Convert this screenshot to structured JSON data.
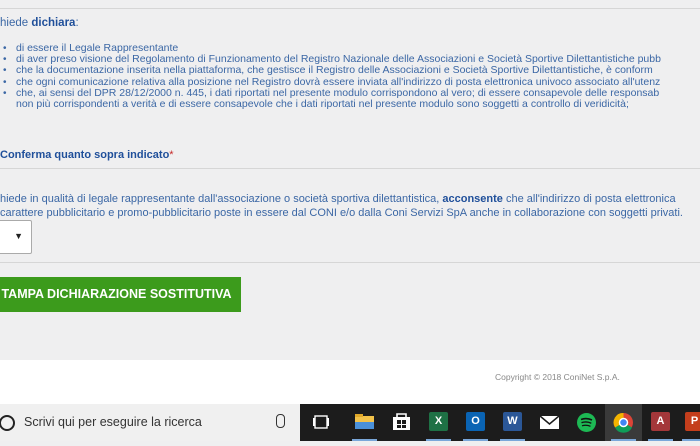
{
  "form": {
    "intro_prefix": "hiede ",
    "intro_bold": "dichiara",
    "intro_suffix": ":",
    "declarations": [
      "di essere il Legale Rappresentante",
      "di aver preso visione del Regolamento di Funzionamento del Registro Nazionale delle Associazioni e Società Sportive Dilettantistiche pubb",
      "che la documentazione inserita nella piattaforma, che gestisce il Registro delle Associazioni e Società Sportive Dilettantistiche, è conform",
      "che ogni comunicazione relativa alla posizione nel Registro dovrà essere inviata all'indirizzo di posta elettronica univoco associato all'utenz",
      "che, ai sensi del DPR 28/12/2000 n. 445, i dati riportati nel presente modulo corrispondono al vero; di essere consapevole delle responsab"
    ],
    "declaration_continuation": "non più corrispondenti a verità e di essere consapevole che i dati riportati nel presente modulo sono soggetti a controllo di veridicità;",
    "conferma_label": "Conferma quanto sopra indicato",
    "required_mark": "*",
    "consenso_line1_prefix": "hiede in qualità di legale rappresentante dall'associazione o società sportiva dilettantistica, ",
    "consenso_bold": "acconsente",
    "consenso_line1_suffix": " che all'indirizzo di posta elettronica",
    "consenso_line2": "carattere pubblicitario e promo-pubblicitario poste in essere dal CONI e/o dalla Coni Servizi SpA anche in collaborazione con soggetti privati.",
    "select_caret": "▼",
    "print_button": "TAMPA DICHIARAZIONE SOSTITUTIVA"
  },
  "footer": {
    "copyright": "Copyright © 2018 ConiNet S.p.A."
  },
  "taskbar": {
    "search_placeholder": "Scrivi qui per eseguire la ricerca",
    "apps": [
      {
        "name": "file-explorer-icon",
        "label": ""
      },
      {
        "name": "store-icon",
        "label": ""
      },
      {
        "name": "excel-icon",
        "label": "X"
      },
      {
        "name": "outlook-icon",
        "label": "O"
      },
      {
        "name": "word-icon",
        "label": "W"
      },
      {
        "name": "mail-icon",
        "label": ""
      },
      {
        "name": "spotify-icon",
        "label": ""
      },
      {
        "name": "chrome-icon",
        "label": ""
      },
      {
        "name": "access-icon",
        "label": "A"
      },
      {
        "name": "powerpoint-icon",
        "label": "P"
      }
    ],
    "colors": {
      "excel": "#1e7145",
      "outlook": "#0a64b4",
      "word": "#2b5797",
      "spotify": "#1db954",
      "access": "#a4373a",
      "powerpoint": "#c43e1c",
      "accent_green": "#3c9b1c"
    }
  }
}
